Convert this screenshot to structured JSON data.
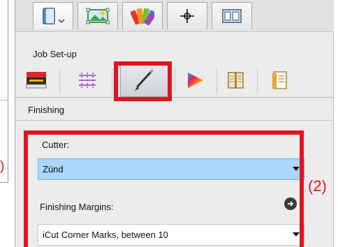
{
  "top_tabs": [
    {
      "icon": "book-icon",
      "active": true
    },
    {
      "icon": "image-frame-icon",
      "active": false
    },
    {
      "icon": "swatch-icon",
      "active": false
    },
    {
      "icon": "crosshair-icon",
      "active": false
    },
    {
      "icon": "layout-icon",
      "active": false
    }
  ],
  "job_setup": {
    "title": "Job Set-up",
    "tools": [
      {
        "icon": "printer-icon",
        "selected": false
      },
      {
        "icon": "grid-dots-icon",
        "selected": false
      },
      {
        "icon": "cutter-blade-icon",
        "selected": true
      },
      {
        "icon": "color-prism-icon",
        "selected": false
      },
      {
        "icon": "booklet-icon",
        "selected": false
      },
      {
        "icon": "document-icon",
        "selected": false
      }
    ]
  },
  "finishing": {
    "title": "Finishing",
    "cutter_label": "Cutter:",
    "cutter_value": "Zünd",
    "margins_label": "Finishing Margins:",
    "margins_value": "iCut Corner Marks, between 10"
  },
  "annotations": {
    "callout_label": "(2)",
    "left_fragment": ")",
    "color": "#e0141e"
  }
}
